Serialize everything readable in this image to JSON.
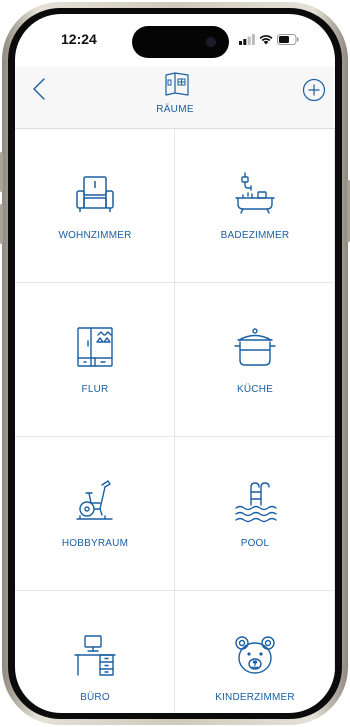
{
  "status_bar": {
    "time": "12:24"
  },
  "header": {
    "title": "RÄUME",
    "title_icon": "rooms-book-icon",
    "back_icon": "chevron-left-icon",
    "add_icon": "plus-circle-icon"
  },
  "rooms": [
    {
      "label": "WOHNZIMMER",
      "icon": "armchair-icon"
    },
    {
      "label": "BADEZIMMER",
      "icon": "bathtub-icon"
    },
    {
      "label": "FLUR",
      "icon": "wardrobe-icon"
    },
    {
      "label": "KÜCHE",
      "icon": "cooking-pot-icon"
    },
    {
      "label": "HOBBYRAUM",
      "icon": "exercise-bike-icon"
    },
    {
      "label": "POOL",
      "icon": "pool-ladder-icon"
    },
    {
      "label": "BÜRO",
      "icon": "desk-computer-icon"
    },
    {
      "label": "KINDERZIMMER",
      "icon": "teddy-bear-icon"
    }
  ],
  "colors": {
    "accent": "#1a5fa3",
    "header_bg": "#f7f7f7",
    "divider": "#e4e7eb"
  }
}
